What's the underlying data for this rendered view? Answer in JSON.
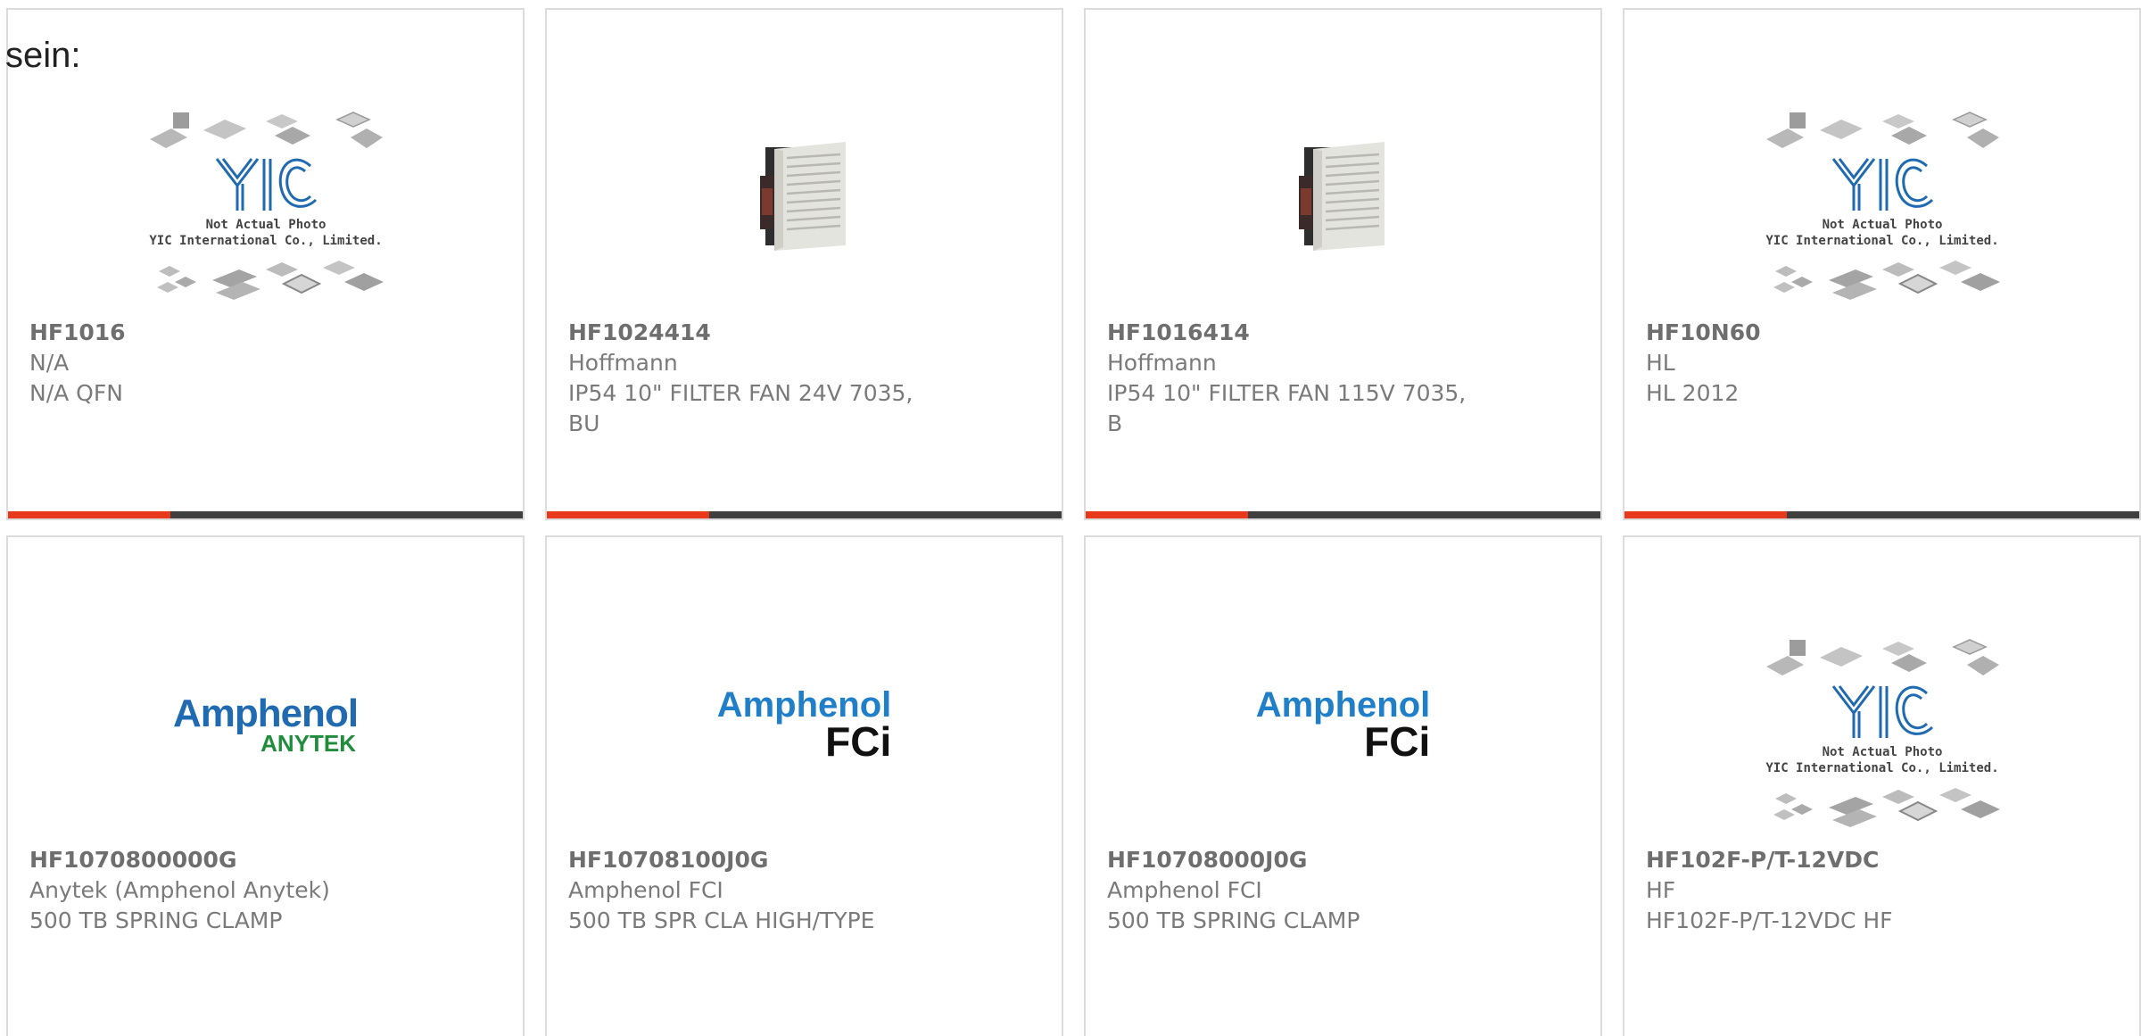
{
  "intro_text": "sein:",
  "colors": {
    "accent_bar": "#e8391d",
    "dark_bar": "#3f3f3f",
    "amphenol_blue": "#1f6ab1",
    "anytek_green": "#1f8d3c"
  },
  "placeholder_image": {
    "line1": "Not Actual Photo",
    "line2": "YIC International Co., Limited.",
    "logo_text": "YIC"
  },
  "logos": {
    "anytek": {
      "brand": "Amphenol",
      "sub": "ANYTEK"
    },
    "fci": {
      "brand": "Amphenol",
      "sub": "FCi"
    }
  },
  "products": [
    {
      "part_number": "HF1016",
      "manufacturer": "N/A",
      "description": "N/A QFN",
      "image": "yic-placeholder"
    },
    {
      "part_number": "HF1024414",
      "manufacturer": "Hoffmann",
      "description": "IP54 10\" FILTER FAN 24V 7035, BU",
      "image": "filter-fan"
    },
    {
      "part_number": "HF1016414",
      "manufacturer": "Hoffmann",
      "description": "IP54 10\" FILTER FAN 115V 7035, B",
      "image": "filter-fan"
    },
    {
      "part_number": "HF10N60",
      "manufacturer": "HL",
      "description": "HL 2012",
      "image": "yic-placeholder"
    },
    {
      "part_number": "HF1070800000G",
      "manufacturer": "Anytek (Amphenol Anytek)",
      "description": "500 TB SPRING CLAMP",
      "image": "amphenol-anytek-logo"
    },
    {
      "part_number": "HF10708100J0G",
      "manufacturer": "Amphenol FCI",
      "description": "500 TB SPR CLA HIGH/TYPE",
      "image": "amphenol-fci-logo"
    },
    {
      "part_number": "HF10708000J0G",
      "manufacturer": "Amphenol FCI",
      "description": "500 TB SPRING CLAMP",
      "image": "amphenol-fci-logo"
    },
    {
      "part_number": "HF102F-P/T-12VDC",
      "manufacturer": "HF",
      "description": "HF102F-P/T-12VDC HF",
      "image": "yic-placeholder"
    }
  ]
}
